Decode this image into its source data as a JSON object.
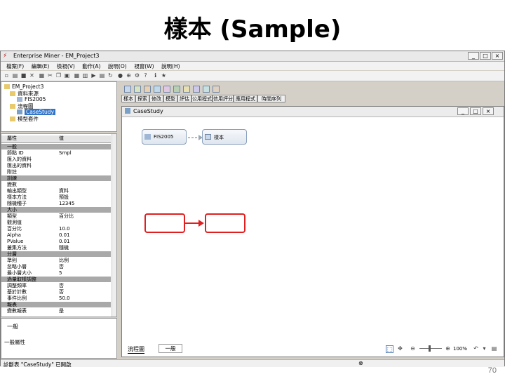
{
  "slide": {
    "title": "樣本 (Sample)",
    "page_number": "70"
  },
  "window": {
    "title": "Enterprise Miner - EM_Project3",
    "controls": [
      "_",
      "□",
      "×"
    ]
  },
  "menu": [
    "檔案(F)",
    "編輯(E)",
    "檢視(V)",
    "動作(A)",
    "說明(O)",
    "視窗(W)",
    "說明(H)"
  ],
  "tree": {
    "root": "EM_Project3",
    "items": [
      "資料來源",
      "FIS2005",
      "流程圖",
      "CaseStudy",
      "模型套件"
    ]
  },
  "properties": {
    "col_name": "屬性",
    "col_value": "值",
    "rows": [
      {
        "name": "一般",
        "value": "",
        "header": true
      },
      {
        "name": "節點 ID",
        "value": "Smpl"
      },
      {
        "name": "匯入的資料",
        "value": ""
      },
      {
        "name": "匯出的資料",
        "value": ""
      },
      {
        "name": "附註",
        "value": ""
      },
      {
        "name": "訓練",
        "value": "",
        "header": true
      },
      {
        "name": "變數",
        "value": ""
      },
      {
        "name": "輸出類型",
        "value": "資料"
      },
      {
        "name": "樣本方法",
        "value": "預設"
      },
      {
        "name": "隨機種子",
        "value": "12345"
      },
      {
        "name": "大小",
        "value": "",
        "header": true
      },
      {
        "name": "類型",
        "value": "百分比"
      },
      {
        "name": "觀測值",
        "value": ""
      },
      {
        "name": "百分比",
        "value": "10.0"
      },
      {
        "name": "Alpha",
        "value": "0.01"
      },
      {
        "name": "PValue",
        "value": "0.01"
      },
      {
        "name": "叢集方法",
        "value": "隨機"
      },
      {
        "name": "分層",
        "value": "",
        "header": true
      },
      {
        "name": "準則",
        "value": "比例"
      },
      {
        "name": "忽略小層",
        "value": "否"
      },
      {
        "name": "最小層大小",
        "value": "5"
      },
      {
        "name": "過量取樣調整",
        "value": "",
        "header": true
      },
      {
        "name": "調整頻率",
        "value": "否"
      },
      {
        "name": "基於計數",
        "value": "否"
      },
      {
        "name": "事件比例",
        "value": "50.0"
      },
      {
        "name": "報表",
        "value": "",
        "header": true
      },
      {
        "name": "變數報表",
        "value": "是"
      }
    ]
  },
  "help_pane": {
    "heading": "一般",
    "text": "一般屬性"
  },
  "node_toolbar_icons": [
    "sample-node-icon",
    "filter-node-icon",
    "merge-node-icon",
    "partition-node-icon",
    "impute-node-icon",
    "tree-node-icon",
    "regression-node-icon",
    "cluster-node-icon",
    "assess-node-icon",
    "score-node-icon"
  ],
  "tabs": [
    "樣本",
    "探索",
    "修改",
    "模型",
    "評估",
    "公用程式",
    "信用評分",
    "應用程式",
    "時間序列"
  ],
  "diagram": {
    "title": "CaseStudy",
    "nodes": [
      "FIS2005",
      "樣本"
    ],
    "tab_label": "流程圖",
    "log_label": "一般",
    "zoom": "100%"
  },
  "status": {
    "left": "診斷表 \"CaseStudy\" 已開啟",
    "right": ""
  },
  "colors": {
    "highlight": "#e02020",
    "selection": "#3174c8",
    "header_row": "#a9a9a9"
  }
}
